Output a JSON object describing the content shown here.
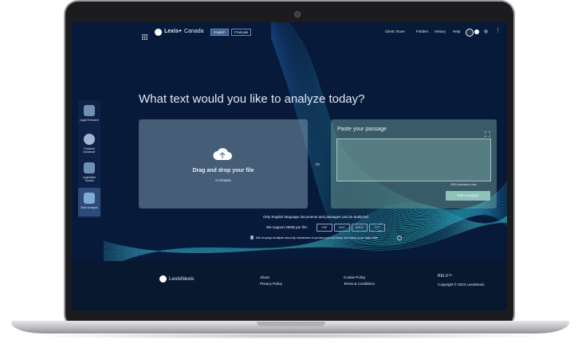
{
  "header": {
    "brand": "Lexis+",
    "brand_sub": "Canada",
    "lang_english": "English",
    "lang_french": "Français",
    "nav": [
      "Client: None",
      "Folders",
      "History",
      "Help"
    ]
  },
  "main": {
    "headline": "What text would you like to analyze today?",
    "drop_title": "Drag and drop your file",
    "drop_sub": "or browse",
    "or_label": "Or",
    "paste_title": "Paste your passage",
    "char_count": "5000 characters max",
    "analyze_button": "Start analysis",
    "notice_english": "Only English language documents and passages can be analyzed.",
    "supported_label": "We support 25MB per file:",
    "formats": [
      "PDF",
      "DOC",
      "DOCX",
      "TXT"
    ],
    "security_note": "We employ multiple security measures to protect your privacy and keep your data safe"
  },
  "rail": {
    "items": [
      "Legal Research",
      "Practical Guidance",
      "Legislative Tracker",
      "Brief Analysis"
    ]
  },
  "footer": {
    "logo": "LexisNexis",
    "links_col1": [
      "About",
      "Privacy Policy"
    ],
    "links_col2": [
      "Cookie Policy",
      "Terms & Conditions"
    ],
    "relx": "RELX™",
    "copyright": "Copyright © 2022 LexisNexis."
  },
  "colors": {
    "screen_bg": "#071a3a",
    "wave_teal": "#2fd1b0",
    "wave_blue": "#3e7bd6",
    "analyze_btn": "#8fc2b8"
  },
  "icons": [
    "grid-icon",
    "lexis-logo-icon",
    "moon-icon",
    "user-icon",
    "more-icon",
    "cloud-upload-icon",
    "expand-icon",
    "info-icon",
    "shield-icon"
  ]
}
